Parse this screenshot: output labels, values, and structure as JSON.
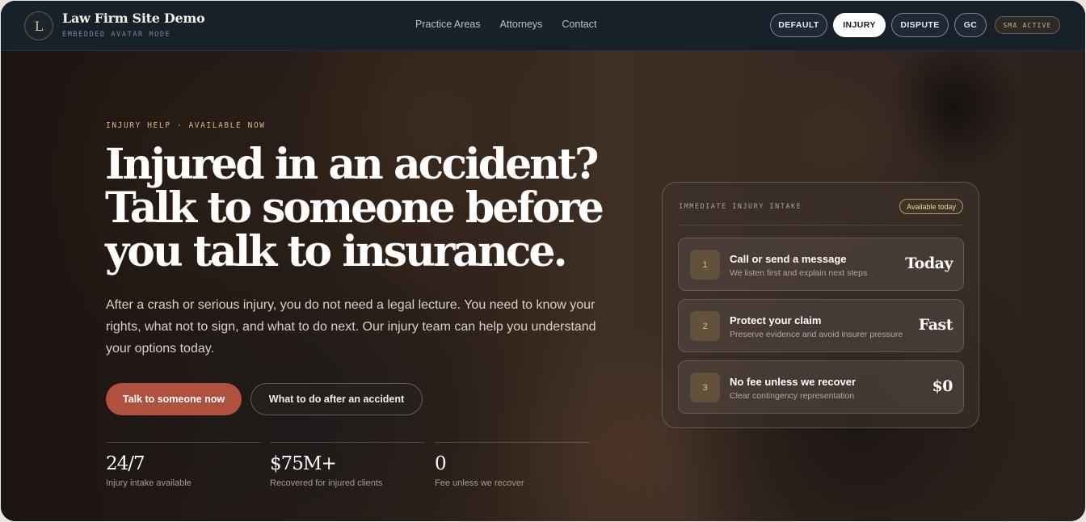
{
  "nav": {
    "logo_letter": "L",
    "title": "Law Firm Site Demo",
    "subtitle": "EMBEDDED AVATAR MODE",
    "links": [
      "Practice Areas",
      "Attorneys",
      "Contact"
    ],
    "modes": [
      "DEFAULT",
      "INJURY",
      "DISPUTE",
      "GC"
    ],
    "active_mode": "INJURY",
    "status_pill": "SMA ACTIVE"
  },
  "hero": {
    "eyebrow": "INJURY HELP · AVAILABLE NOW",
    "headline_lines": [
      "Injured in an accident?",
      "Talk to someone before",
      "you talk to insurance."
    ],
    "lead": "After a crash or serious injury, you do not need a legal lecture. You need to know your rights, what not to sign, and what to do next. Our injury team can help you understand your options today.",
    "cta_primary": "Talk to someone now",
    "cta_secondary": "What to do after an accident",
    "stats": [
      {
        "value": "24/7",
        "label": "Injury intake available"
      },
      {
        "value": "$75M+",
        "label": "Recovered for injured clients"
      },
      {
        "value": "0",
        "label": "Fee unless we recover"
      }
    ]
  },
  "intake": {
    "title": "IMMEDIATE INJURY INTAKE",
    "badge": "Available today",
    "steps": [
      {
        "num": "1",
        "title": "Call or send a message",
        "desc": "We listen first and explain next steps",
        "value": "Today"
      },
      {
        "num": "2",
        "title": "Protect your claim",
        "desc": "Preserve evidence and avoid insurer pressure",
        "value": "Fast"
      },
      {
        "num": "3",
        "title": "No fee unless we recover",
        "desc": "Clear contingency representation",
        "value": "$0"
      }
    ]
  },
  "colors": {
    "accent": "#b0503f",
    "gold": "#d7b882",
    "nav_bg": "#182029"
  }
}
